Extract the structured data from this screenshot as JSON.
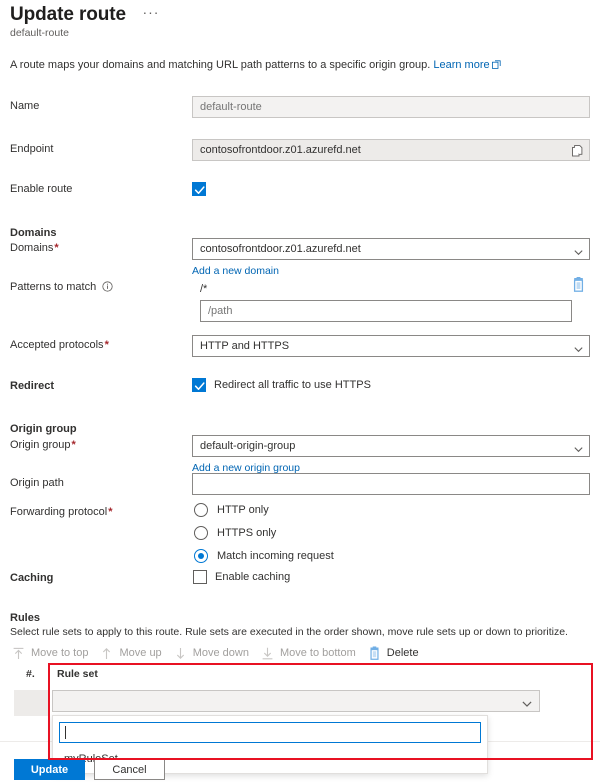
{
  "header": {
    "title": "Update route",
    "subtitle": "default-route",
    "ellipsis": "···"
  },
  "intro": {
    "text": "A route maps your domains and matching URL path patterns to a specific origin group.",
    "link": "Learn more",
    "link_icon": "external-link-icon"
  },
  "fields": {
    "name": {
      "label": "Name",
      "value": "default-route",
      "placeholder": "default-route",
      "disabled": true
    },
    "endpoint": {
      "label": "Endpoint",
      "value": "contosofrontdoor.z01.azurefd.net",
      "copy_icon": "copy-icon",
      "readonly": true
    },
    "enable_route": {
      "label": "Enable route",
      "checked": true
    }
  },
  "domains_section": {
    "heading": "Domains",
    "domains": {
      "label": "Domains",
      "required": "*",
      "value": "contosofrontdoor.z01.azurefd.net",
      "add_link": "Add a new domain"
    },
    "patterns": {
      "label": "Patterns to match",
      "info_icon": "info-icon",
      "existing_pattern": "/*",
      "delete_icon": "delete-icon",
      "new_placeholder": "/path",
      "new_value": ""
    },
    "accepted_protocols": {
      "label": "Accepted protocols",
      "required": "*",
      "value": "HTTP and HTTPS"
    }
  },
  "redirect": {
    "label": "Redirect",
    "checkbox_label": "Redirect all traffic to use HTTPS",
    "checked": true
  },
  "origin_group_section": {
    "heading": "Origin group",
    "origin_group": {
      "label": "Origin group",
      "required": "*",
      "value": "default-origin-group",
      "add_link": "Add a new origin group"
    },
    "origin_path": {
      "label": "Origin path",
      "value": "",
      "placeholder": ""
    },
    "forwarding_protocol": {
      "label": "Forwarding protocol",
      "required": "*",
      "options": [
        {
          "label": "HTTP only",
          "selected": false
        },
        {
          "label": "HTTPS only",
          "selected": false
        },
        {
          "label": "Match incoming request",
          "selected": true
        }
      ]
    }
  },
  "caching": {
    "label": "Caching",
    "checkbox_label": "Enable caching",
    "checked": false
  },
  "rules": {
    "heading": "Rules",
    "description": "Select rule sets to apply to this route. Rule sets are executed in the order shown, move rule sets up or down to prioritize.",
    "toolbar": [
      {
        "label": "Move to top",
        "icon": "move-to-top-icon",
        "enabled": false
      },
      {
        "label": "Move up",
        "icon": "arrow-up-icon",
        "enabled": false
      },
      {
        "label": "Move down",
        "icon": "arrow-down-icon",
        "enabled": false
      },
      {
        "label": "Move to bottom",
        "icon": "move-to-bottom-icon",
        "enabled": false
      },
      {
        "label": "Delete",
        "icon": "delete-icon",
        "enabled": true
      }
    ],
    "table": {
      "col_number": "#.",
      "col_rule_set": "Rule set"
    },
    "rule_set_combo": {
      "value": "",
      "chevron_icon": "chevron-down-icon"
    },
    "dropdown": {
      "search_value": "",
      "options": [
        "myRuleSet"
      ]
    }
  },
  "footer": {
    "update_label": "Update",
    "cancel_label": "Cancel"
  },
  "colors": {
    "accent": "#0078d4",
    "link": "#0065b3",
    "required": "#a4262c",
    "annotation": "#e81123",
    "disabled_bg": "#f3f2f1",
    "readonly_bg": "#edebe9"
  }
}
